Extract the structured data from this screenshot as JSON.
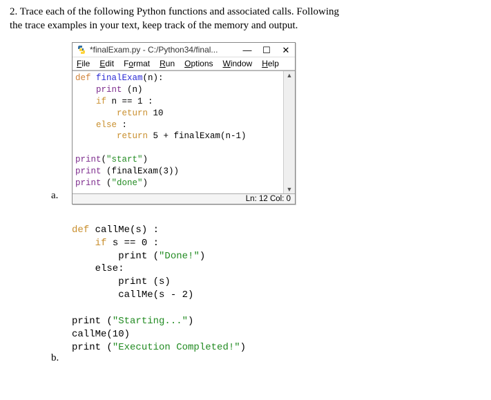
{
  "question": {
    "num": "2.",
    "text1": "Trace each of the following Python functions and associated calls.  Following",
    "text2": "the trace examples in your text, keep track of the memory and output."
  },
  "labels": {
    "a": "a.",
    "b": "b."
  },
  "idle": {
    "title": "*finalExam.py - C:/Python34/final...",
    "btn_min": "—",
    "btn_max": "☐",
    "btn_close": "✕",
    "menu": {
      "file": {
        "u": "F",
        "rest": "ile"
      },
      "edit": {
        "u": "E",
        "rest": "dit"
      },
      "format": {
        "u": "o",
        "pre": "F",
        "rest": "rmat"
      },
      "run": {
        "u": "R",
        "rest": "un"
      },
      "options": {
        "u": "O",
        "rest": "ptions"
      },
      "window": {
        "u": "W",
        "rest": "indow"
      },
      "help": {
        "u": "H",
        "rest": "elp"
      }
    },
    "code": {
      "l1a": "def ",
      "l1b": "finalExam",
      "l1c": "(n):",
      "l2a": "    ",
      "l2b": "print ",
      "l2c": "(n)",
      "l3a": "    ",
      "l3b": "if",
      "l3c": " n == 1 :",
      "l4a": "        ",
      "l4b": "return",
      "l4c": " 10",
      "l5a": "    ",
      "l5b": "else ",
      "l5c": ":",
      "l6a": "        ",
      "l6b": "return",
      "l6c": " 5 + finalExam(n-1)",
      "blank": "",
      "l7a": "",
      "l7b": "print",
      "l7c": "(",
      "l7d": "\"start\"",
      "l7e": ")",
      "l8a": "",
      "l8b": "print ",
      "l8c": "(finalExam(3))",
      "l9a": "",
      "l9b": "print ",
      "l9c": "(",
      "l9d": "\"done\"",
      "l9e": ")"
    },
    "status": "Ln: 12 Col: 0",
    "scroll_up": "▲",
    "scroll_dn": "▼"
  },
  "code2": {
    "l1a": "def",
    "l1b": " callMe(s) :",
    "l2a": "    ",
    "l2b": "if",
    "l2c": " s == 0 :",
    "l3a": "        print (",
    "l3b": "\"Done!\"",
    "l3c": ")",
    "l4": "    else:",
    "l5": "        print (s)",
    "l6": "        callMe(s - 2)",
    "blank": "",
    "l7a": "print (",
    "l7b": "\"Starting...\"",
    "l7c": ")",
    "l8": "callMe(10)",
    "l9a": "print (",
    "l9b": "\"Execution Completed!\"",
    "l9c": ")"
  }
}
